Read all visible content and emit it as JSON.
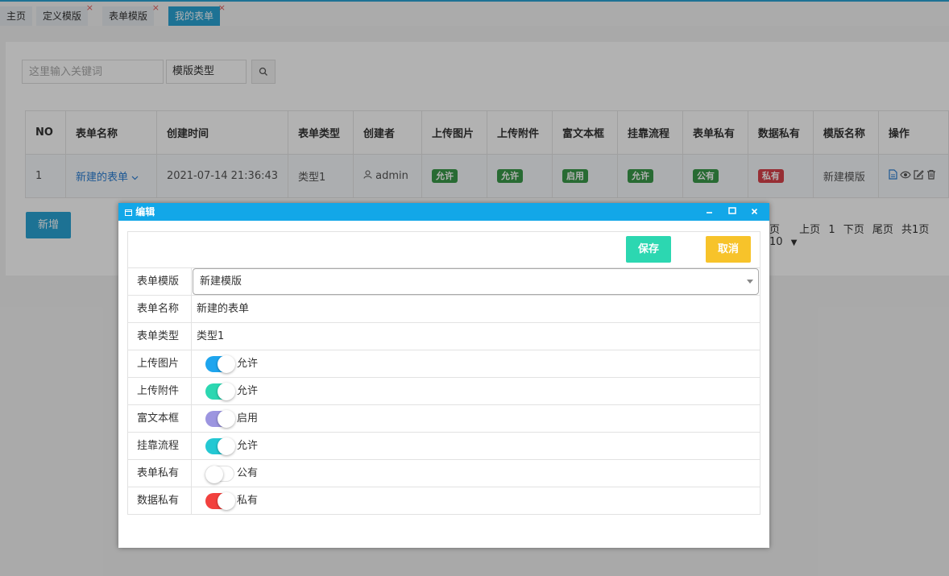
{
  "tabs": [
    {
      "label": "主页",
      "closable": false,
      "active": false
    },
    {
      "label": "定义模版",
      "closable": true,
      "active": false
    },
    {
      "label": "表单模版",
      "closable": true,
      "active": false
    },
    {
      "label": "我的表单",
      "closable": true,
      "active": true
    }
  ],
  "tab_close_glyph": "×",
  "search": {
    "placeholder": "这里输入关键词",
    "type_label": "模版类型"
  },
  "table": {
    "headers": [
      "NO",
      "表单名称",
      "创建时间",
      "表单类型",
      "创建者",
      "上传图片",
      "上传附件",
      "富文本框",
      "挂靠流程",
      "表单私有",
      "数据私有",
      "模版名称",
      "操作"
    ],
    "rows": [
      {
        "no": "1",
        "name": "新建的表单",
        "created": "2021-07-14 21:36:43",
        "type": "类型1",
        "creator": "admin",
        "upload_image": "允许",
        "upload_file": "允许",
        "rich_text": "启用",
        "flow": "允许",
        "form_private": "公有",
        "data_private": "私有",
        "template": "新建模版"
      }
    ]
  },
  "add_label": "新增",
  "pager": {
    "first": "页",
    "prev": "上页",
    "page": "1",
    "next": "下页",
    "last": "尾页",
    "total": "共1页",
    "size": "10"
  },
  "dialog": {
    "title": "编辑",
    "save": "保存",
    "cancel": "取消",
    "fields": {
      "template_label": "表单模版",
      "template_value": "新建模版",
      "name_label": "表单名称",
      "name_value": "新建的表单",
      "type_label": "表单类型",
      "type_value": "类型1"
    },
    "toggles": [
      {
        "label": "上传图片",
        "value": "允许",
        "on": true,
        "color": "#1ea5ee"
      },
      {
        "label": "上传附件",
        "value": "允许",
        "on": true,
        "color": "#2cd7b1"
      },
      {
        "label": "富文本框",
        "value": "启用",
        "on": true,
        "color": "#9c95e0"
      },
      {
        "label": "挂靠流程",
        "value": "允许",
        "on": true,
        "color": "#24c8d3"
      },
      {
        "label": "表单私有",
        "value": "公有",
        "on": false,
        "color": "#ffffff"
      },
      {
        "label": "数据私有",
        "value": "私有",
        "on": true,
        "color": "#f2413e"
      }
    ]
  },
  "colors": {
    "accent": "#2aa4d5",
    "dialog_title": "#12a7e8",
    "badge_green": "#3a9a49",
    "badge_red": "#d9434b"
  }
}
